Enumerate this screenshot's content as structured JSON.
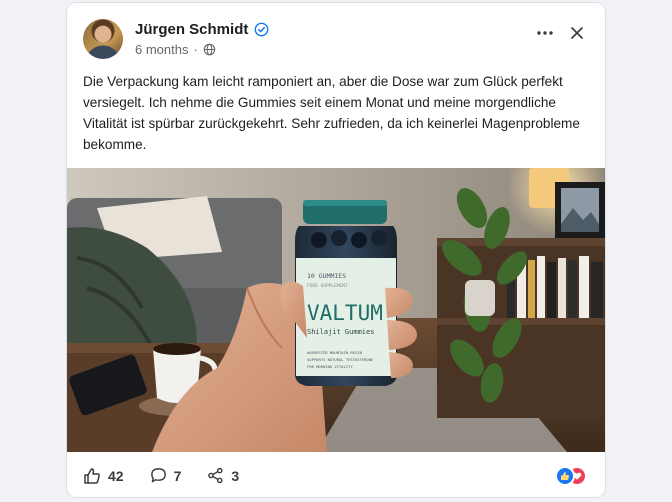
{
  "post": {
    "author": "Jürgen Schmidt",
    "verified_icon": "verified-check-icon",
    "timestamp": "6 months",
    "separator": "·",
    "visibility_icon": "globe-icon",
    "text": "Die Verpackung kam leicht ramponiert an, aber die Dose war zum Glück perfekt versiegelt. Ich nehme die Gummies seit einem Monat und meine morgendliche Vitalität ist spürbar zurückgekehrt. Sehr zufrieden, da ich keinerlei Magenprobleme bekomme."
  },
  "product_label": {
    "count": "10 GUMMIES",
    "subline": "FOOD SUPPLEMENT",
    "brand": "VALTUM",
    "product": "Shilajit Gummies",
    "claim1": "HARVESTED MOUNTAIN RESIN",
    "claim2": "SUPPORTS NATURAL TESTOSTERONE",
    "claim3": "FOR MORNING VITALITY"
  },
  "footer": {
    "likes": "42",
    "comments": "7",
    "shares": "3"
  },
  "colors": {
    "accent": "#1877f2",
    "verified": "#1877f2",
    "love": "#f33e58",
    "jar_lid": "#1f6e6a",
    "label": "#e4efe6"
  }
}
